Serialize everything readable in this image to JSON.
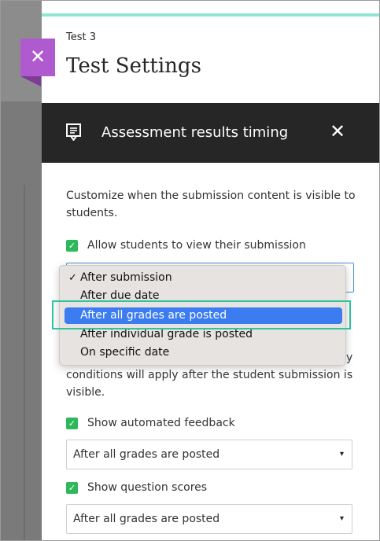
{
  "panel": {
    "course_name": "Test 3",
    "title": "Test Settings",
    "close_icon": "close-icon"
  },
  "header": {
    "title": "Assessment results timing",
    "icon": "comment-icon",
    "close_icon": "close-icon"
  },
  "description": "Customize when the submission content is visible to students.",
  "view_submission": {
    "checked": true,
    "label": "Allow students to view their submission"
  },
  "dropdown": {
    "options": [
      {
        "label": "After submission",
        "checked": true
      },
      {
        "label": "After due date",
        "checked": false
      },
      {
        "label": "After all grades are posted",
        "checked": false,
        "highlighted": true
      },
      {
        "label": "After individual grade is posted",
        "checked": false
      },
      {
        "label": "On specific date",
        "checked": false
      }
    ]
  },
  "conditions_text": "conditions will apply after the student submission is visible.",
  "conditions_partial": "y",
  "feedback": {
    "checked": true,
    "label": "Show automated feedback",
    "value": "After all grades are posted"
  },
  "scores": {
    "checked": true,
    "label": "Show question scores",
    "value": "After all grades are posted"
  },
  "colors": {
    "accent": "#8fe7d3",
    "purple": "#b05ad0",
    "header_bg": "#262626",
    "check_green": "#2db85c",
    "selection_blue": "#3b7cf0",
    "highlight_teal": "#2ec4a0"
  }
}
